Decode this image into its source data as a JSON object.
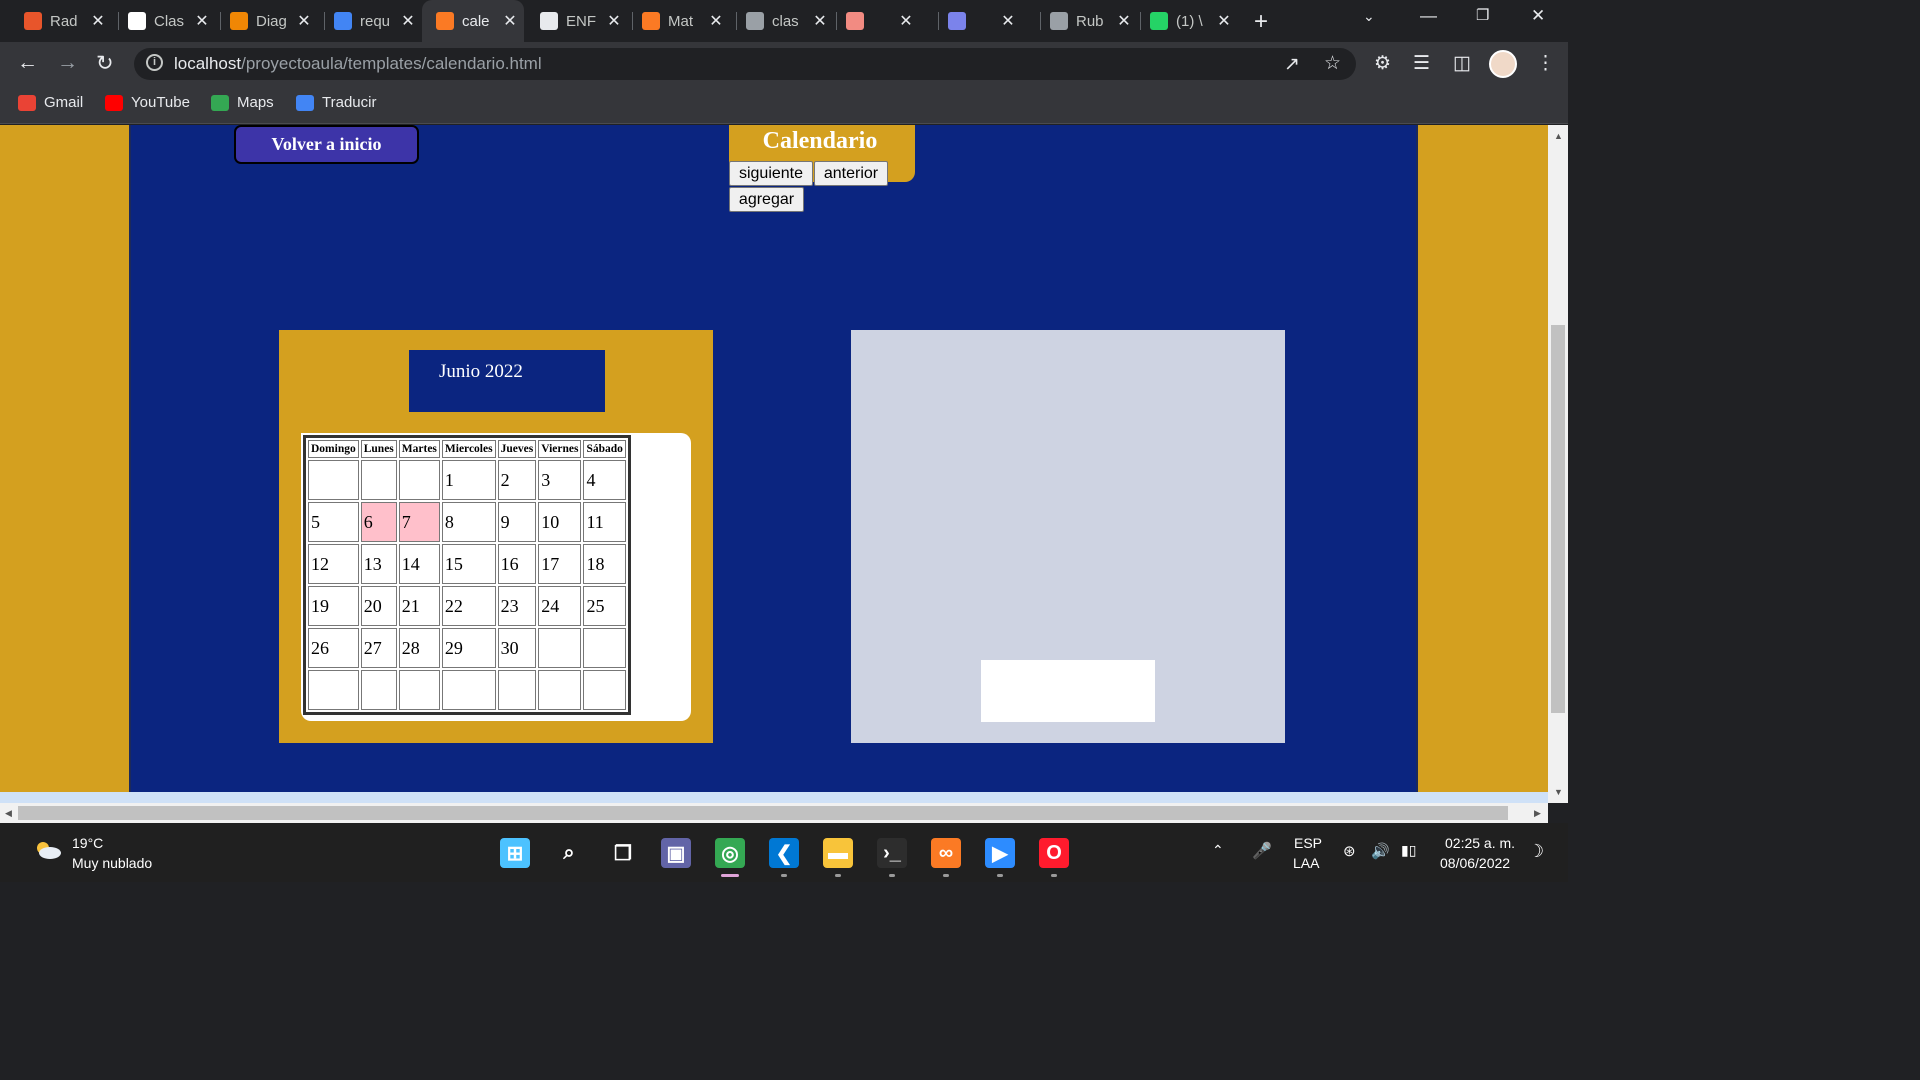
{
  "browser": {
    "tabs": [
      {
        "title": "Rad",
        "icon": "radio-icon",
        "color": "#e8552b"
      },
      {
        "title": "Clas",
        "icon": "classroom-icon",
        "color": "#ffffff"
      },
      {
        "title": "Diag",
        "icon": "diagram-icon",
        "color": "#f08705"
      },
      {
        "title": "requ",
        "icon": "docs-icon",
        "color": "#4285f4"
      },
      {
        "title": "cale",
        "icon": "xampp-icon",
        "color": "#fb7a24",
        "active": true
      },
      {
        "title": "ENF",
        "icon": "edge-icon",
        "color": "#e8eaed"
      },
      {
        "title": "Mat",
        "icon": "xampp-icon",
        "color": "#fb7a24"
      },
      {
        "title": "clas",
        "icon": "globe-icon",
        "color": "#9aa0a6"
      },
      {
        "title": "",
        "icon": "record-icon",
        "color": "#f28b82"
      },
      {
        "title": "",
        "icon": "teams-icon",
        "color": "#7b83eb"
      },
      {
        "title": "Rub",
        "icon": "globe-icon",
        "color": "#9aa0a6"
      },
      {
        "title": "(1) \\",
        "icon": "whatsapp-icon",
        "color": "#25d366"
      }
    ],
    "url_host": "localhost",
    "url_path": "/proyectoaula/templates/calendario.html",
    "bookmarks": [
      {
        "label": "Gmail",
        "icon": "gmail-icon",
        "color": "#ea4335"
      },
      {
        "label": "YouTube",
        "icon": "youtube-icon",
        "color": "#ff0000"
      },
      {
        "label": "Maps",
        "icon": "maps-icon",
        "color": "#34a853"
      },
      {
        "label": "Traducir",
        "icon": "translate-icon",
        "color": "#4285f4"
      }
    ]
  },
  "page": {
    "home_button": "Volver a inicio",
    "title": "Calendario",
    "next_button": "siguiente",
    "prev_button": "anterior",
    "add_button": "agregar",
    "month_label": "Junio 2022",
    "weekdays": [
      "Domingo",
      "Lunes",
      "Martes",
      "Miercoles",
      "Jueves",
      "Viernes",
      "Sábado"
    ],
    "weeks": [
      [
        "",
        "",
        "",
        "1",
        "2",
        "3",
        "4"
      ],
      [
        "5",
        "6",
        "7",
        "8",
        "9",
        "10",
        "11"
      ],
      [
        "12",
        "13",
        "14",
        "15",
        "16",
        "17",
        "18"
      ],
      [
        "19",
        "20",
        "21",
        "22",
        "23",
        "24",
        "25"
      ],
      [
        "26",
        "27",
        "28",
        "29",
        "30",
        "",
        ""
      ],
      [
        "",
        "",
        "",
        "",
        "",
        "",
        ""
      ]
    ],
    "highlighted_days": [
      "6",
      "7"
    ],
    "highlight_color": "#ffc0cb",
    "colors": {
      "background": "#d4a01f",
      "main": "#0b2580",
      "panel": "#ced3e2",
      "home_button": "#3d34a8"
    }
  },
  "taskbar": {
    "temperature": "19°C",
    "weather": "Muy nublado",
    "apps": [
      "windows-start-icon",
      "search-icon",
      "task-view-icon",
      "chat-icon",
      "chrome-icon",
      "vscode-icon",
      "file-explorer-icon",
      "terminal-icon",
      "xampp-icon",
      "zoom-icon",
      "opera-icon"
    ],
    "lang_top": "ESP",
    "lang_bottom": "LAA",
    "time": "02:25 a. m.",
    "date": "08/06/2022"
  }
}
